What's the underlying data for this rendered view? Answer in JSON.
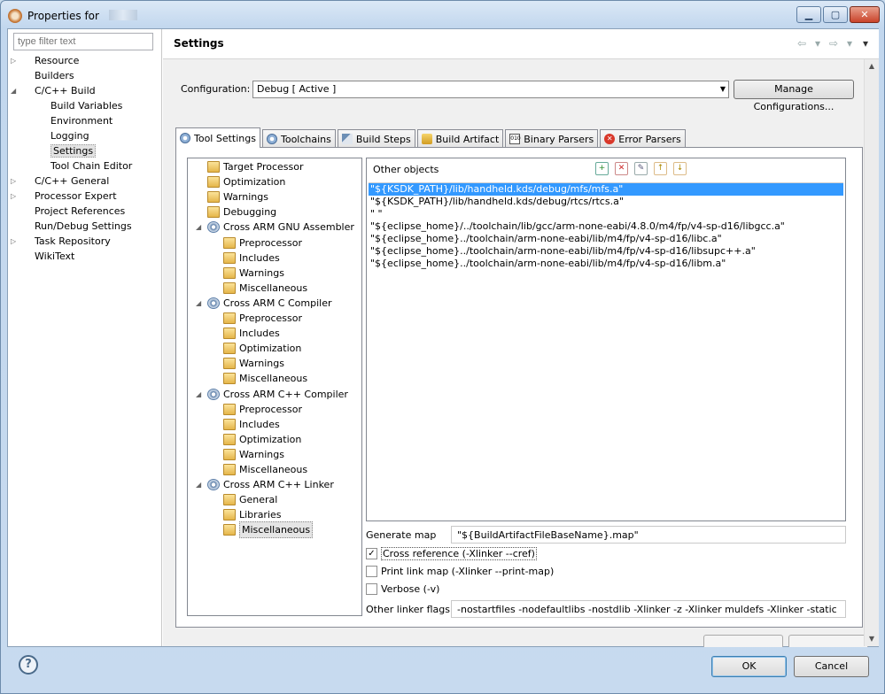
{
  "window": {
    "title": "Properties for",
    "controls": {
      "minimize": "▁",
      "maximize": "▢",
      "close": "✕"
    }
  },
  "filter": {
    "placeholder": "type filter text"
  },
  "nav_tree": [
    {
      "label": "Resource",
      "twisty": "▷"
    },
    {
      "label": "Builders",
      "twisty": ""
    },
    {
      "label": "C/C++ Build",
      "twisty": "◢"
    },
    {
      "label": "Build Variables",
      "twisty": ""
    },
    {
      "label": "Environment",
      "twisty": ""
    },
    {
      "label": "Logging",
      "twisty": ""
    },
    {
      "label": "Settings",
      "twisty": ""
    },
    {
      "label": "Tool Chain Editor",
      "twisty": ""
    },
    {
      "label": "C/C++ General",
      "twisty": "▷"
    },
    {
      "label": "Processor Expert",
      "twisty": "▷"
    },
    {
      "label": "Project References",
      "twisty": ""
    },
    {
      "label": "Run/Debug Settings",
      "twisty": ""
    },
    {
      "label": "Task Repository",
      "twisty": "▷"
    },
    {
      "label": "WikiText",
      "twisty": ""
    }
  ],
  "header": {
    "title": "Settings",
    "back": "⇦",
    "forward": "⇨",
    "menu": "▾"
  },
  "configuration": {
    "label": "Configuration:",
    "value": "Debug  [ Active ]",
    "manage_label": "Manage Configurations..."
  },
  "tabs": [
    {
      "label": "Tool Settings",
      "icon": "tool-settings-icon"
    },
    {
      "label": "Toolchains",
      "icon": "toolchains-icon"
    },
    {
      "label": "Build Steps",
      "icon": "build-steps-icon"
    },
    {
      "label": "Build Artifact",
      "icon": "build-artifact-icon"
    },
    {
      "label": "Binary Parsers",
      "icon": "binary-parsers-icon"
    },
    {
      "label": "Error Parsers",
      "icon": "error-parsers-icon"
    }
  ],
  "tool_tree": [
    {
      "label": "Target Processor",
      "icon": "folder"
    },
    {
      "label": "Optimization",
      "icon": "folder"
    },
    {
      "label": "Warnings",
      "icon": "folder"
    },
    {
      "label": "Debugging",
      "icon": "folder"
    },
    {
      "label": "Cross ARM GNU Assembler",
      "icon": "gear"
    },
    {
      "label": "Preprocessor",
      "icon": "folder"
    },
    {
      "label": "Includes",
      "icon": "folder"
    },
    {
      "label": "Warnings",
      "icon": "folder"
    },
    {
      "label": "Miscellaneous",
      "icon": "folder"
    },
    {
      "label": "Cross ARM C Compiler",
      "icon": "gear"
    },
    {
      "label": "Preprocessor",
      "icon": "folder"
    },
    {
      "label": "Includes",
      "icon": "folder"
    },
    {
      "label": "Optimization",
      "icon": "folder"
    },
    {
      "label": "Warnings",
      "icon": "folder"
    },
    {
      "label": "Miscellaneous",
      "icon": "folder"
    },
    {
      "label": "Cross ARM C++ Compiler",
      "icon": "gear"
    },
    {
      "label": "Preprocessor",
      "icon": "folder"
    },
    {
      "label": "Includes",
      "icon": "folder"
    },
    {
      "label": "Optimization",
      "icon": "folder"
    },
    {
      "label": "Warnings",
      "icon": "folder"
    },
    {
      "label": "Miscellaneous",
      "icon": "folder"
    },
    {
      "label": "Cross ARM C++ Linker",
      "icon": "gear"
    },
    {
      "label": "General",
      "icon": "folder"
    },
    {
      "label": "Libraries",
      "icon": "folder"
    },
    {
      "label": "Miscellaneous",
      "icon": "folder"
    }
  ],
  "other_objects": {
    "title": "Other objects",
    "items": [
      "\"${KSDK_PATH}/lib/handheld.kds/debug/mfs/mfs.a\"",
      "\"${KSDK_PATH}/lib/handheld.kds/debug/rtcs/rtcs.a\"",
      "\"                                                                                                                                                           \"",
      "\"${eclipse_home}/../toolchain/lib/gcc/arm-none-eabi/4.8.0/m4/fp/v4-sp-d16/libgcc.a\"",
      "\"${eclipse_home}../toolchain/arm-none-eabi/lib/m4/fp/v4-sp-d16/libc.a\"",
      "\"${eclipse_home}../toolchain/arm-none-eabi/lib/m4/fp/v4-sp-d16/libsupc++.a\"",
      "\"${eclipse_home}../toolchain/arm-none-eabi/lib/m4/fp/v4-sp-d16/libm.a\""
    ]
  },
  "generate_map": {
    "label": "Generate map",
    "value": "\"${BuildArtifactFileBaseName}.map\""
  },
  "checkboxes": [
    {
      "label": "Cross reference (-Xlinker --cref)",
      "checked": true
    },
    {
      "label": "Print link map (-Xlinker --print-map)",
      "checked": false
    },
    {
      "label": "Verbose (-v)",
      "checked": false
    }
  ],
  "linker_flags": {
    "label": "Other linker flags",
    "value": "-nostartfiles -nodefaultlibs -nostdlib -Xlinker -z -Xlinker muldefs -Xlinker -static"
  },
  "footer": {
    "help": "?",
    "ok_label": "OK",
    "cancel_label": "Cancel"
  }
}
